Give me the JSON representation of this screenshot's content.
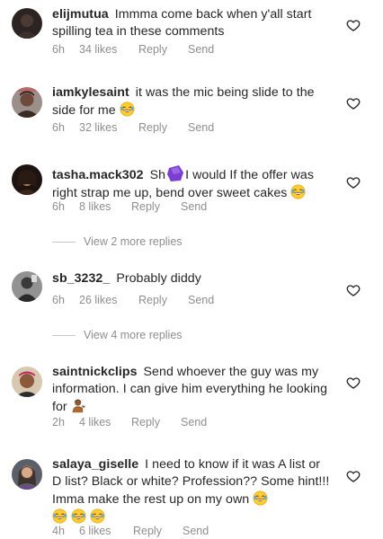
{
  "comments": [
    {
      "username": "elijmutua",
      "text": "Immma come back when y'all start spilling tea in these comments",
      "time": "6h",
      "likes": "34 likes",
      "reply": "Reply",
      "send": "Send"
    },
    {
      "username": "iamkylesaint",
      "text": "it was the mic being slide to the side for me",
      "emoji": "laughing-emoji",
      "time": "6h",
      "likes": "32 likes",
      "reply": "Reply",
      "send": "Send"
    },
    {
      "username": "tasha.mack302",
      "text_a": "Sh",
      "text_b": "I would If the offer was right strap me up, bend over sweet cakes",
      "sticker": "purple-shape",
      "emoji": "laughing-emoji",
      "time": "6h",
      "likes": "8 likes",
      "reply": "Reply",
      "send": "Send"
    },
    {
      "username": "sb_3232_",
      "text": "Probably diddy",
      "time": "6h",
      "likes": "26 likes",
      "reply": "Reply",
      "send": "Send"
    },
    {
      "username": "saintnickclips",
      "text": "Send whoever the guy was my information. I can give him everything he looking for",
      "emoji": "person-tipping-hand-emoji",
      "time": "2h",
      "likes": "4 likes",
      "reply": "Reply",
      "send": "Send"
    },
    {
      "username": "salaya_giselle",
      "text": "I need to know if it was A list or D list? Black or white? Profession?? Some hint!!! Imma make the rest up on my own",
      "emoji": "laughing-emoji",
      "time": "4h",
      "likes": "6 likes",
      "reply": "Reply",
      "send": "Send"
    }
  ],
  "view_replies": [
    "View 2 more replies",
    "View 4 more replies"
  ],
  "colors": {
    "text": "#262626",
    "meta": "#8e8e8e",
    "heart_outline": "#8e8e8e"
  },
  "icons": [
    "heart-outline-icon",
    "avatar",
    "laughing-emoji",
    "person-tipping-hand-emoji"
  ]
}
